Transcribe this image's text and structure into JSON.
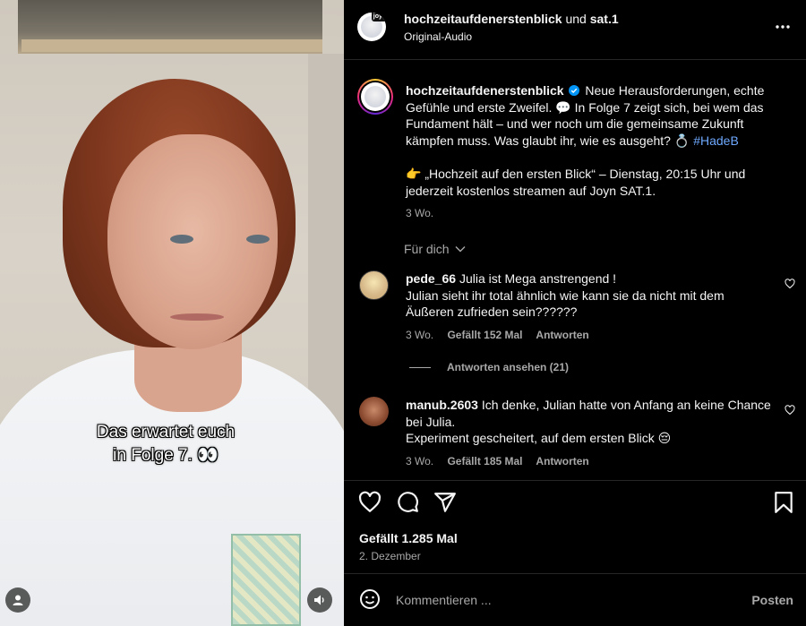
{
  "video": {
    "caption_line1": "Das erwartet euch",
    "caption_line2": "in Folge 7. 👀",
    "user_icon": "user-icon",
    "volume_icon": "volume-icon"
  },
  "header": {
    "account1": "hochzeitaufdenerstenblick",
    "joiner": "und",
    "account2": "sat.1",
    "audio": "Original-Audio",
    "more_icon": "more-horizontal-icon"
  },
  "post": {
    "author": "hochzeitaufdenerstenblick",
    "verified_icon": "verified-badge-icon",
    "caption_part1": "Neue Herausforderungen, echte Gefühle und erste Zweifel. 💬 In Folge 7 zeigt sich, bei wem das Fundament hält – und wer noch um die gemeinsame Zukunft kämpfen muss. Was glaubt ihr, wie es ausgeht? 💍 ",
    "hashtag": "#HadeB",
    "caption_part2": "👉 „Hochzeit auf den ersten Blick“ – Dienstag, 20:15 Uhr und jederzeit kostenlos streamen auf Joyn SAT.1.",
    "time": "3 Wo."
  },
  "filter": {
    "label": "Für dich"
  },
  "comments": [
    {
      "user": "pede_66",
      "line1": "Julia ist Mega anstrengend !",
      "line2": "Julian sieht ihr total ähnlich wie kann sie da nicht mit dem Äußeren zufrieden sein??????",
      "time": "3 Wo.",
      "likes": "Gefällt 152 Mal",
      "reply": "Antworten",
      "view_replies": "Antworten ansehen (21)"
    },
    {
      "user": "manub.2603",
      "line1": "Ich denke, Julian hatte von Anfang an keine Chance bei Julia.",
      "line2": "Experiment gescheitert, auf dem ersten Blick 😔",
      "time": "3 Wo.",
      "likes": "Gefällt 185 Mal",
      "reply": "Antworten"
    }
  ],
  "actions": {
    "likes": "Gefällt 1.285 Mal",
    "date": "2. Dezember",
    "icons": [
      "heart-icon",
      "comment-icon",
      "share-icon",
      "bookmark-icon"
    ]
  },
  "composer": {
    "placeholder": "Kommentieren ...",
    "post_label": "Posten",
    "emoji_icon": "emoji-icon"
  },
  "colors": {
    "background": "#000000",
    "text": "#f5f5f5",
    "secondary": "#a8a8a8",
    "hashtag": "#6ea8fe",
    "divider": "#262626"
  }
}
